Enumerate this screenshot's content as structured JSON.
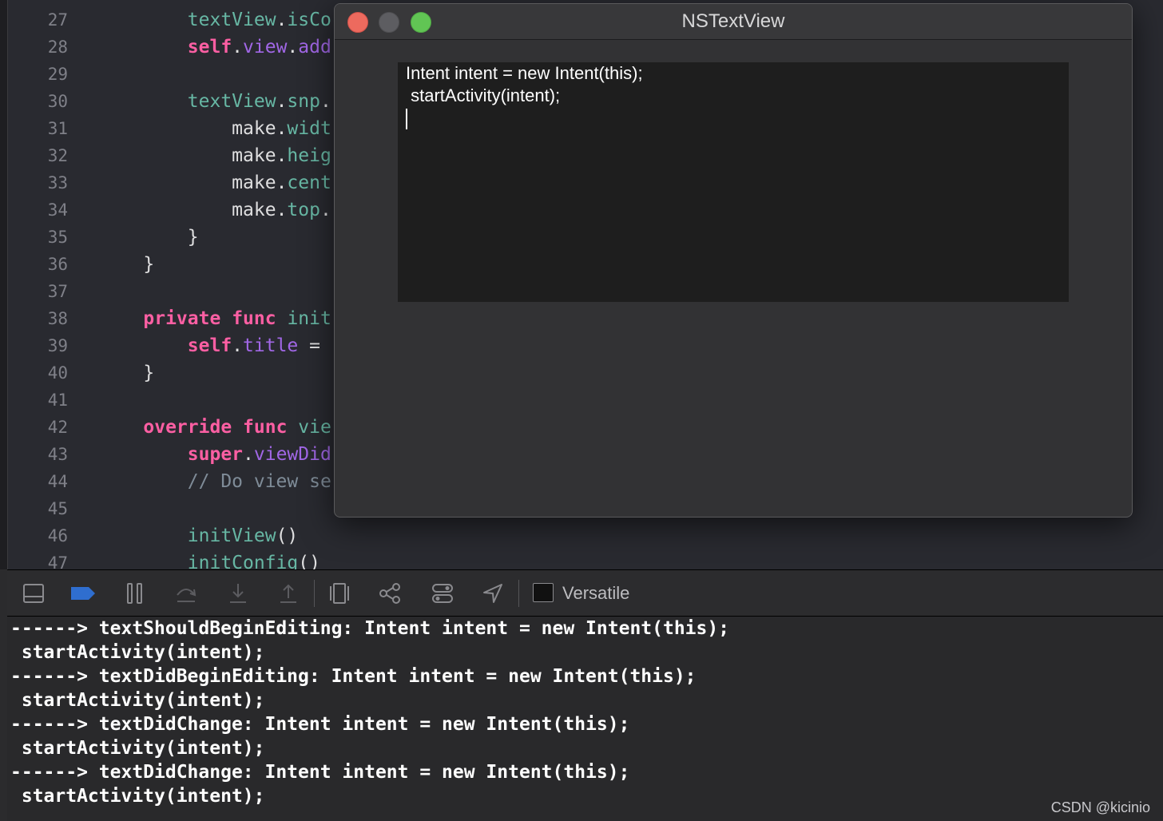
{
  "editor": {
    "lines": [
      {
        "n": "27",
        "tokens": [
          {
            "t": "        ",
            "c": "pl"
          },
          {
            "t": "textView",
            "c": "id"
          },
          {
            "t": ".",
            "c": "pl"
          },
          {
            "t": "isCo",
            "c": "id"
          }
        ]
      },
      {
        "n": "28",
        "tokens": [
          {
            "t": "        ",
            "c": "pl"
          },
          {
            "t": "self",
            "c": "kw"
          },
          {
            "t": ".",
            "c": "pl"
          },
          {
            "t": "view",
            "c": "prop"
          },
          {
            "t": ".",
            "c": "pl"
          },
          {
            "t": "add",
            "c": "prop"
          }
        ]
      },
      {
        "n": "29",
        "tokens": []
      },
      {
        "n": "30",
        "tokens": [
          {
            "t": "        ",
            "c": "pl"
          },
          {
            "t": "textView",
            "c": "id"
          },
          {
            "t": ".",
            "c": "pl"
          },
          {
            "t": "snp",
            "c": "id"
          },
          {
            "t": ".",
            "c": "pl"
          }
        ]
      },
      {
        "n": "31",
        "tokens": [
          {
            "t": "            ",
            "c": "pl"
          },
          {
            "t": "make",
            "c": "pl"
          },
          {
            "t": ".",
            "c": "pl"
          },
          {
            "t": "widt",
            "c": "id"
          }
        ]
      },
      {
        "n": "32",
        "tokens": [
          {
            "t": "            ",
            "c": "pl"
          },
          {
            "t": "make",
            "c": "pl"
          },
          {
            "t": ".",
            "c": "pl"
          },
          {
            "t": "heig",
            "c": "id"
          }
        ]
      },
      {
        "n": "33",
        "tokens": [
          {
            "t": "            ",
            "c": "pl"
          },
          {
            "t": "make",
            "c": "pl"
          },
          {
            "t": ".",
            "c": "pl"
          },
          {
            "t": "cent",
            "c": "id"
          }
        ]
      },
      {
        "n": "34",
        "tokens": [
          {
            "t": "            ",
            "c": "pl"
          },
          {
            "t": "make",
            "c": "pl"
          },
          {
            "t": ".",
            "c": "pl"
          },
          {
            "t": "top",
            "c": "id"
          },
          {
            "t": ".",
            "c": "pl"
          }
        ]
      },
      {
        "n": "35",
        "tokens": [
          {
            "t": "        }",
            "c": "pl"
          }
        ]
      },
      {
        "n": "36",
        "tokens": [
          {
            "t": "    }",
            "c": "pl"
          }
        ]
      },
      {
        "n": "37",
        "tokens": []
      },
      {
        "n": "38",
        "tokens": [
          {
            "t": "    ",
            "c": "pl"
          },
          {
            "t": "private",
            "c": "kw"
          },
          {
            "t": " ",
            "c": "pl"
          },
          {
            "t": "func",
            "c": "kw"
          },
          {
            "t": " ",
            "c": "pl"
          },
          {
            "t": "init",
            "c": "id"
          }
        ]
      },
      {
        "n": "39",
        "tokens": [
          {
            "t": "        ",
            "c": "pl"
          },
          {
            "t": "self",
            "c": "kw"
          },
          {
            "t": ".",
            "c": "pl"
          },
          {
            "t": "title",
            "c": "prop"
          },
          {
            "t": " =",
            "c": "pl"
          }
        ]
      },
      {
        "n": "40",
        "tokens": [
          {
            "t": "    }",
            "c": "pl"
          }
        ]
      },
      {
        "n": "41",
        "tokens": []
      },
      {
        "n": "42",
        "tokens": [
          {
            "t": "    ",
            "c": "pl"
          },
          {
            "t": "override",
            "c": "kw"
          },
          {
            "t": " ",
            "c": "pl"
          },
          {
            "t": "func",
            "c": "kw"
          },
          {
            "t": " ",
            "c": "pl"
          },
          {
            "t": "vie",
            "c": "id"
          }
        ]
      },
      {
        "n": "43",
        "tokens": [
          {
            "t": "        ",
            "c": "pl"
          },
          {
            "t": "super",
            "c": "kw"
          },
          {
            "t": ".",
            "c": "pl"
          },
          {
            "t": "viewDid",
            "c": "prop"
          }
        ]
      },
      {
        "n": "44",
        "tokens": [
          {
            "t": "        ",
            "c": "pl"
          },
          {
            "t": "// Do view se",
            "c": "cm"
          }
        ]
      },
      {
        "n": "45",
        "tokens": []
      },
      {
        "n": "46",
        "tokens": [
          {
            "t": "        ",
            "c": "pl"
          },
          {
            "t": "initView",
            "c": "id"
          },
          {
            "t": "()",
            "c": "pl"
          }
        ]
      },
      {
        "n": "47",
        "tokens": [
          {
            "t": "        ",
            "c": "pl"
          },
          {
            "t": "initConfig",
            "c": "id"
          },
          {
            "t": "()",
            "c": "pl"
          }
        ]
      }
    ]
  },
  "window": {
    "title": "NSTextView",
    "text_lines": [
      "Intent intent = new Intent(this);",
      " startActivity(intent);"
    ]
  },
  "debug_bar": {
    "buttons": [
      "hide-debug-area-icon",
      "breakpoints-icon",
      "pause-icon",
      "step-over-icon",
      "step-into-icon",
      "step-out-icon",
      "view-hierarchy-icon",
      "memory-graph-icon",
      "environment-overrides-icon",
      "simulate-location-icon"
    ],
    "target_label": "Versatile"
  },
  "console": {
    "lines": [
      "------> textShouldBeginEditing: Intent intent = new Intent(this);",
      " startActivity(intent);",
      "------> textDidBeginEditing: Intent intent = new Intent(this);",
      " startActivity(intent);",
      "------> textDidChange: Intent intent = new Intent(this);",
      " startActivity(intent);",
      "------> textDidChange: Intent intent = new Intent(this);",
      " startActivity(intent);"
    ]
  },
  "watermark": "CSDN @kicinio",
  "colors": {
    "keyword": "#fc5fa3",
    "identifier": "#67b7a4",
    "property": "#a167e6",
    "comment": "#7f8c98",
    "breakpoint_active": "#2f6ecf"
  }
}
